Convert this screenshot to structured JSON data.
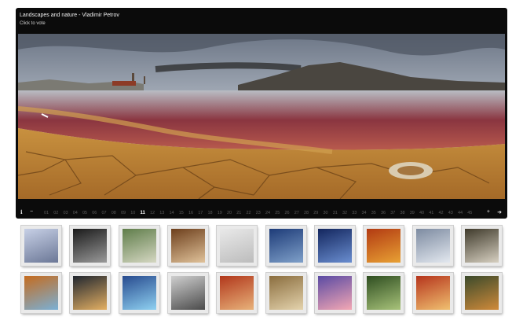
{
  "viewer": {
    "title": "Landscapes and nature - Vladimir Petrov",
    "subtitle": "Click to vote"
  },
  "pager": {
    "info_icon": "info-icon",
    "minus_icon": "minus-icon",
    "plus_icon": "plus-icon",
    "share_icon": "share-icon",
    "current_page": "11",
    "pages": [
      "01",
      "02",
      "03",
      "04",
      "05",
      "06",
      "07",
      "08",
      "09",
      "10",
      "11",
      "12",
      "13",
      "14",
      "15",
      "16",
      "17",
      "18",
      "19",
      "20",
      "21",
      "22",
      "23",
      "24",
      "25",
      "26",
      "27",
      "28",
      "29",
      "30",
      "31",
      "32",
      "33",
      "34",
      "35",
      "36",
      "37",
      "38",
      "39",
      "40",
      "41",
      "42",
      "43",
      "44",
      "45"
    ]
  },
  "thumbnails": {
    "row1": [
      {
        "name": "pier-foggy",
        "c1": "#c7d0e6",
        "c2": "#6b7796"
      },
      {
        "name": "black-white-wave",
        "c1": "#1a1a1a",
        "c2": "#9a9a9a"
      },
      {
        "name": "palm-forest",
        "c1": "#5f7d4a",
        "c2": "#d5d7c2"
      },
      {
        "name": "rock-canyon",
        "c1": "#6d3f1c",
        "c2": "#e0c29a"
      },
      {
        "name": "white-abstract",
        "c1": "#e9e9e9",
        "c2": "#bcbcbc"
      },
      {
        "name": "blue-lake-night",
        "c1": "#1d3b78",
        "c2": "#7fa0c9"
      },
      {
        "name": "ocean-blue",
        "c1": "#13265e",
        "c2": "#6a8ed0"
      },
      {
        "name": "autumn-alley",
        "c1": "#b23a12",
        "c2": "#e8a134"
      },
      {
        "name": "cloudy-sky",
        "c1": "#7d8ba1",
        "c2": "#e3e8ef"
      },
      {
        "name": "pine-trees",
        "c1": "#3f3a2b",
        "c2": "#d7d0c1"
      }
    ],
    "row2": [
      {
        "name": "autumn-lake",
        "c1": "#c56b1e",
        "c2": "#7ab0d6"
      },
      {
        "name": "mountain-sunset",
        "c1": "#20262f",
        "c2": "#e4b063"
      },
      {
        "name": "blue-lagoon",
        "c1": "#274a8e",
        "c2": "#8fd1f1"
      },
      {
        "name": "reflection-water",
        "c1": "#cfcfcf",
        "c2": "#4b4b4b"
      },
      {
        "name": "red-forest",
        "c1": "#b1371b",
        "c2": "#e8b27a"
      },
      {
        "name": "sand-waves",
        "c1": "#8a6d3e",
        "c2": "#e4d3ad"
      },
      {
        "name": "purple-dusk",
        "c1": "#5a4aa3",
        "c2": "#f3a7b4"
      },
      {
        "name": "green-forest",
        "c1": "#2e4d20",
        "c2": "#a8c37a"
      },
      {
        "name": "red-sunrays",
        "c1": "#b5341c",
        "c2": "#f0c070"
      },
      {
        "name": "swamp-trees",
        "c1": "#3b4a2b",
        "c2": "#d08a3a"
      }
    ]
  }
}
